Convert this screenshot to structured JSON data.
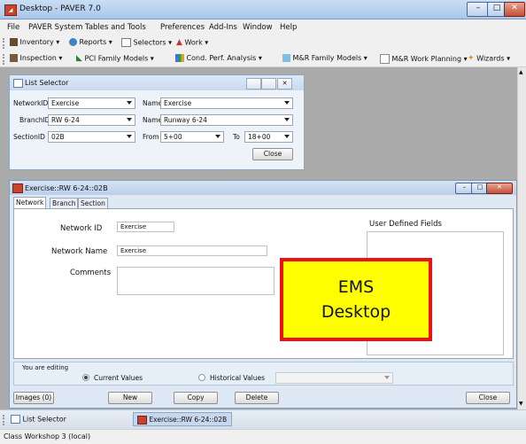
{
  "window": {
    "title": "Desktop - PAVER 7.0"
  },
  "menu": [
    "File",
    "PAVER System Tables and Tools",
    "Preferences",
    "Add-Ins",
    "Window",
    "Help"
  ],
  "toolbar1": [
    "Inventory",
    "Reports",
    "Selectors",
    "Work"
  ],
  "toolbar2": [
    "Inspection",
    "PCI Family Models",
    "Cond. Perf. Analysis",
    "M&R Family Models",
    "M&R Work Planning",
    "Wizards"
  ],
  "list_selector": {
    "title": "List Selector",
    "network_label": "NetworkID",
    "network_value": "Exercise",
    "name1_label": "Name",
    "name1_value": "Exercise",
    "branch_label": "BranchID",
    "branch_value": "RW 6-24",
    "name2_label": "Name",
    "name2_value": "Runway 6-24",
    "section_label": "SectionID",
    "section_value": "02B",
    "from_label": "From",
    "from_value": "5+00",
    "to_label": "To",
    "to_value": "18+00",
    "close_label": "Close"
  },
  "exercise_window": {
    "title": "Exercise::RW 6-24::02B",
    "tabs": [
      "Network",
      "Branch",
      "Section"
    ],
    "network_id_label": "Network ID",
    "network_id_value": "Exercise",
    "network_name_label": "Network Name",
    "network_name_value": "Exercise",
    "comments_label": "Comments",
    "udf_label": "User Defined Fields",
    "editing_label": "You are editing",
    "current_values_label": "Current Values",
    "historical_values_label": "Historical Values",
    "buttons": {
      "images": "Images (0)",
      "new": "New",
      "copy": "Copy",
      "delete": "Delete",
      "close": "Close"
    }
  },
  "overlay": {
    "line1": "EMS",
    "line2": "Desktop"
  },
  "taskbar": [
    "List Selector",
    "Exercise::RW 6-24::02B"
  ],
  "status": "Class Workshop 3 (local)",
  "colors": {
    "overlay_fill": "#ffff00",
    "overlay_border": "#ee1111",
    "desktop": "#ababab"
  }
}
